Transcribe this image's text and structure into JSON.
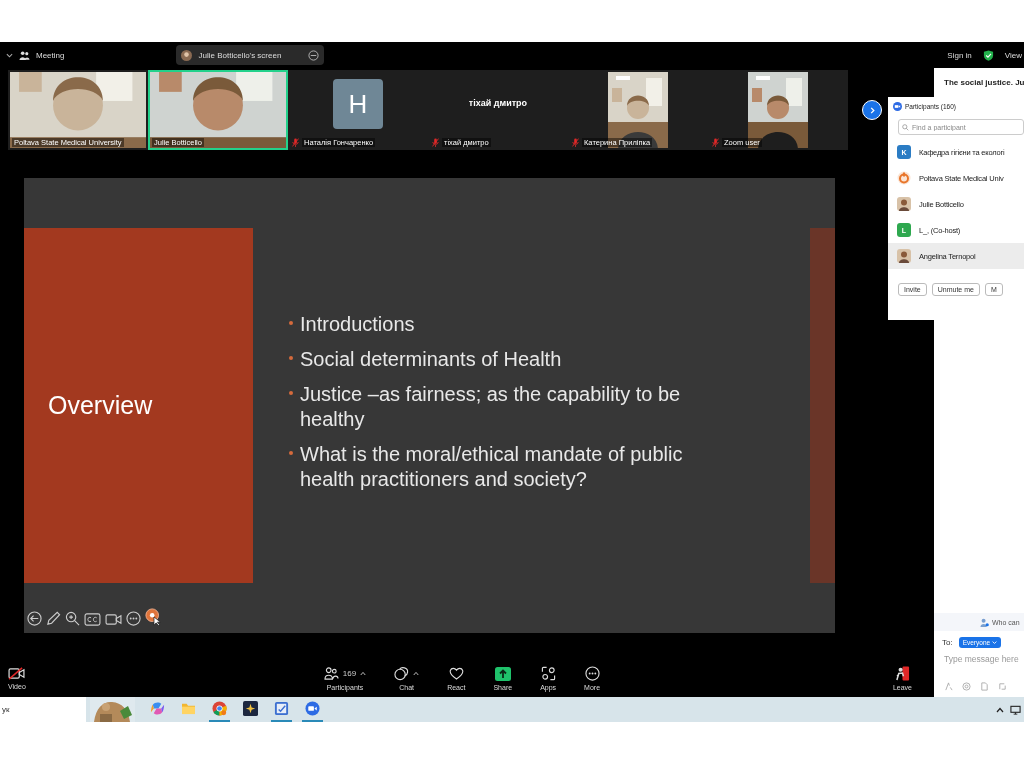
{
  "top_bar": {
    "menu_label": "Meeting",
    "share_label": "Julie Botticello's screen",
    "sign_in": "Sign in",
    "view": "View"
  },
  "tiles": [
    {
      "kind": "video",
      "name": "Poltava State Medical University",
      "muted": false,
      "active": false
    },
    {
      "kind": "video",
      "name": "Julie Botticello",
      "muted": false,
      "active": true
    },
    {
      "kind": "avatar",
      "initial": "H",
      "name": "Наталія Гончаренко",
      "muted": true,
      "active": false
    },
    {
      "kind": "name",
      "display": "тіхай дмитро",
      "name": "тіхай дмитро",
      "muted": true,
      "active": false
    },
    {
      "kind": "portrait",
      "name": "Катерина Прилiпка",
      "muted": true,
      "active": false
    },
    {
      "kind": "portrait",
      "name": "Zoom user",
      "muted": true,
      "active": false
    }
  ],
  "slide": {
    "title": "Overview",
    "bullets": [
      "Introductions",
      "Social determinants of Health",
      "Justice –as fairness; as the capability to be healthy",
      "What is the moral/ethical mandate of public health practitioners and society?"
    ]
  },
  "participants_panel": {
    "title": "Participants (160)",
    "search_placeholder": "Find a participant",
    "items": [
      {
        "kind": "initial",
        "initial": "K",
        "color": "#2b7cc4",
        "name": "Кафедра гігієни та екологі",
        "selected": false
      },
      {
        "kind": "logo",
        "name": "Poltava State Medical Univ",
        "selected": false
      },
      {
        "name": "Julie Botticello",
        "selected": false
      },
      {
        "kind": "initial",
        "initial": "L",
        "color": "#2ea84f",
        "name": "L_, (Co-host)",
        "selected": false
      },
      {
        "name": "Angelina Ternopol",
        "selected": true
      }
    ],
    "buttons": [
      "Invite",
      "Unmute me",
      "M"
    ]
  },
  "chat": {
    "header": "The social justice. Ju",
    "who_can": "Who can",
    "to_label": "To:",
    "recipient": "Everyone",
    "placeholder": "Type message here"
  },
  "toolbar": {
    "left": {
      "kind": "video",
      "label": "Video"
    },
    "center": [
      {
        "kind": "participants",
        "label": "Participants",
        "count": "169"
      },
      {
        "kind": "chat",
        "label": "Chat"
      },
      {
        "kind": "react",
        "label": "React"
      },
      {
        "kind": "share",
        "label": "Share"
      },
      {
        "kind": "apps",
        "label": "Apps"
      },
      {
        "kind": "more",
        "label": "More"
      }
    ],
    "right": {
      "kind": "leave",
      "label": "Leave"
    }
  },
  "taskbar": {
    "search_text": "ук",
    "apps": [
      {
        "kind": "copilot",
        "running": false
      },
      {
        "kind": "folder",
        "running": false
      },
      {
        "kind": "chrome",
        "running": true
      },
      {
        "kind": "star",
        "running": false
      },
      {
        "kind": "notes",
        "running": true
      },
      {
        "kind": "zoom",
        "running": true
      }
    ]
  }
}
